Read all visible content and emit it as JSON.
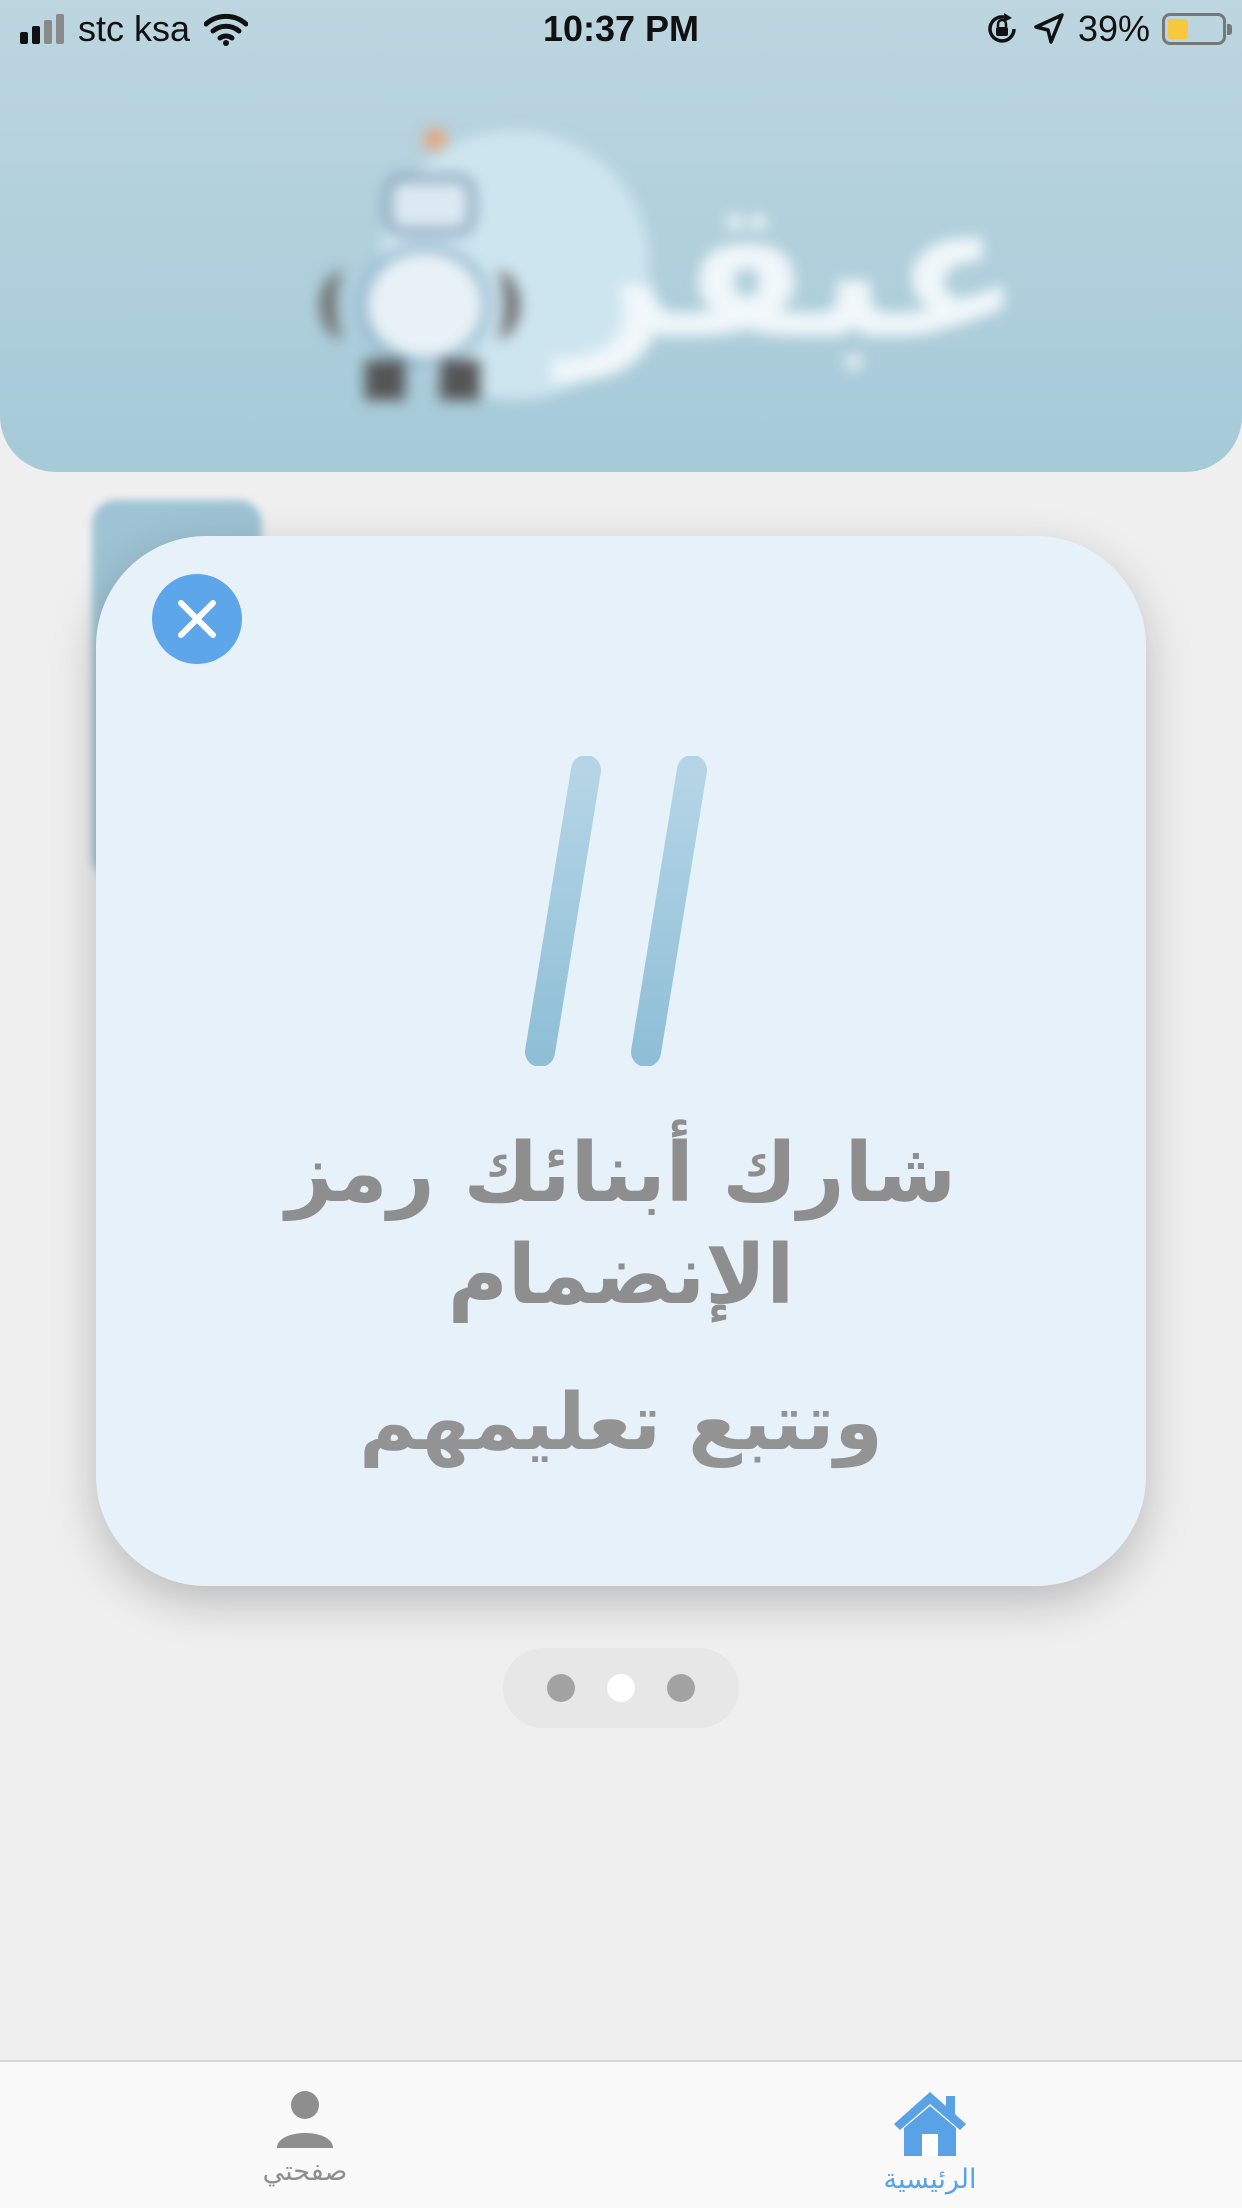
{
  "status_bar": {
    "carrier": "stc ksa",
    "time": "10:37 PM",
    "battery_percent": "39%",
    "battery_level": 0.39,
    "signal_bars_active": 2,
    "icons": [
      "signal-icon",
      "wifi-icon",
      "orientation-lock-icon",
      "location-arrow-icon",
      "battery-icon"
    ]
  },
  "header": {
    "logo_text": "عبقر"
  },
  "modal": {
    "icon": "hashtag-icon",
    "line1": "شارك أبنائك رمز",
    "line2": "الإنضمام",
    "line3": "وتتبع تعليمهم",
    "close_icon": "close-icon",
    "accent_color": "#5da6ea"
  },
  "pager": {
    "count": 3,
    "active_index": 1
  },
  "tab_bar": {
    "tabs": [
      {
        "label": "صفحتي",
        "icon": "person-icon",
        "active": false
      },
      {
        "label": "الرئيسية",
        "icon": "home-icon",
        "active": true
      }
    ],
    "active_color": "#5aa2e6",
    "inactive_color": "#8e8e8e"
  }
}
